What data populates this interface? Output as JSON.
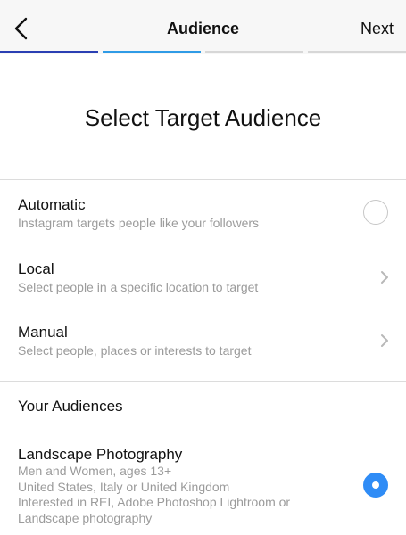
{
  "header": {
    "title": "Audience",
    "next_label": "Next",
    "back_icon": "chevron-left-icon"
  },
  "progress": {
    "total_steps": 4,
    "current_step": 2,
    "segments": [
      {
        "fill": 1.0,
        "color": "#2a3fb3"
      },
      {
        "fill": 1.0,
        "color": "#2f9be6"
      },
      {
        "fill": 0.0,
        "color": "#d7d7d7"
      },
      {
        "fill": 0.0,
        "color": "#d7d7d7"
      }
    ]
  },
  "page": {
    "headline": "Select Target Audience"
  },
  "options": [
    {
      "title": "Automatic",
      "subtitle": "Instagram targets people like your followers",
      "control": "radio",
      "selected": false
    },
    {
      "title": "Local",
      "subtitle": "Select people in a specific location to target",
      "control": "chevron"
    },
    {
      "title": "Manual",
      "subtitle": "Select people, places or interests to target",
      "control": "chevron"
    }
  ],
  "your_audiences": {
    "section_title": "Your Audiences",
    "items": [
      {
        "title": "Landscape Photography",
        "lines": [
          "Men and Women, ages 13+",
          "United States, Italy or United Kingdom",
          "Interested in REI, Adobe Photoshop Lightroom or",
          "Landscape photography"
        ],
        "selected": true
      }
    ]
  },
  "colors": {
    "accent": "#2f8cf6",
    "muted_text": "#9b9b9b",
    "divider": "#dcdcdc",
    "header_bg": "#f7f7f7"
  }
}
